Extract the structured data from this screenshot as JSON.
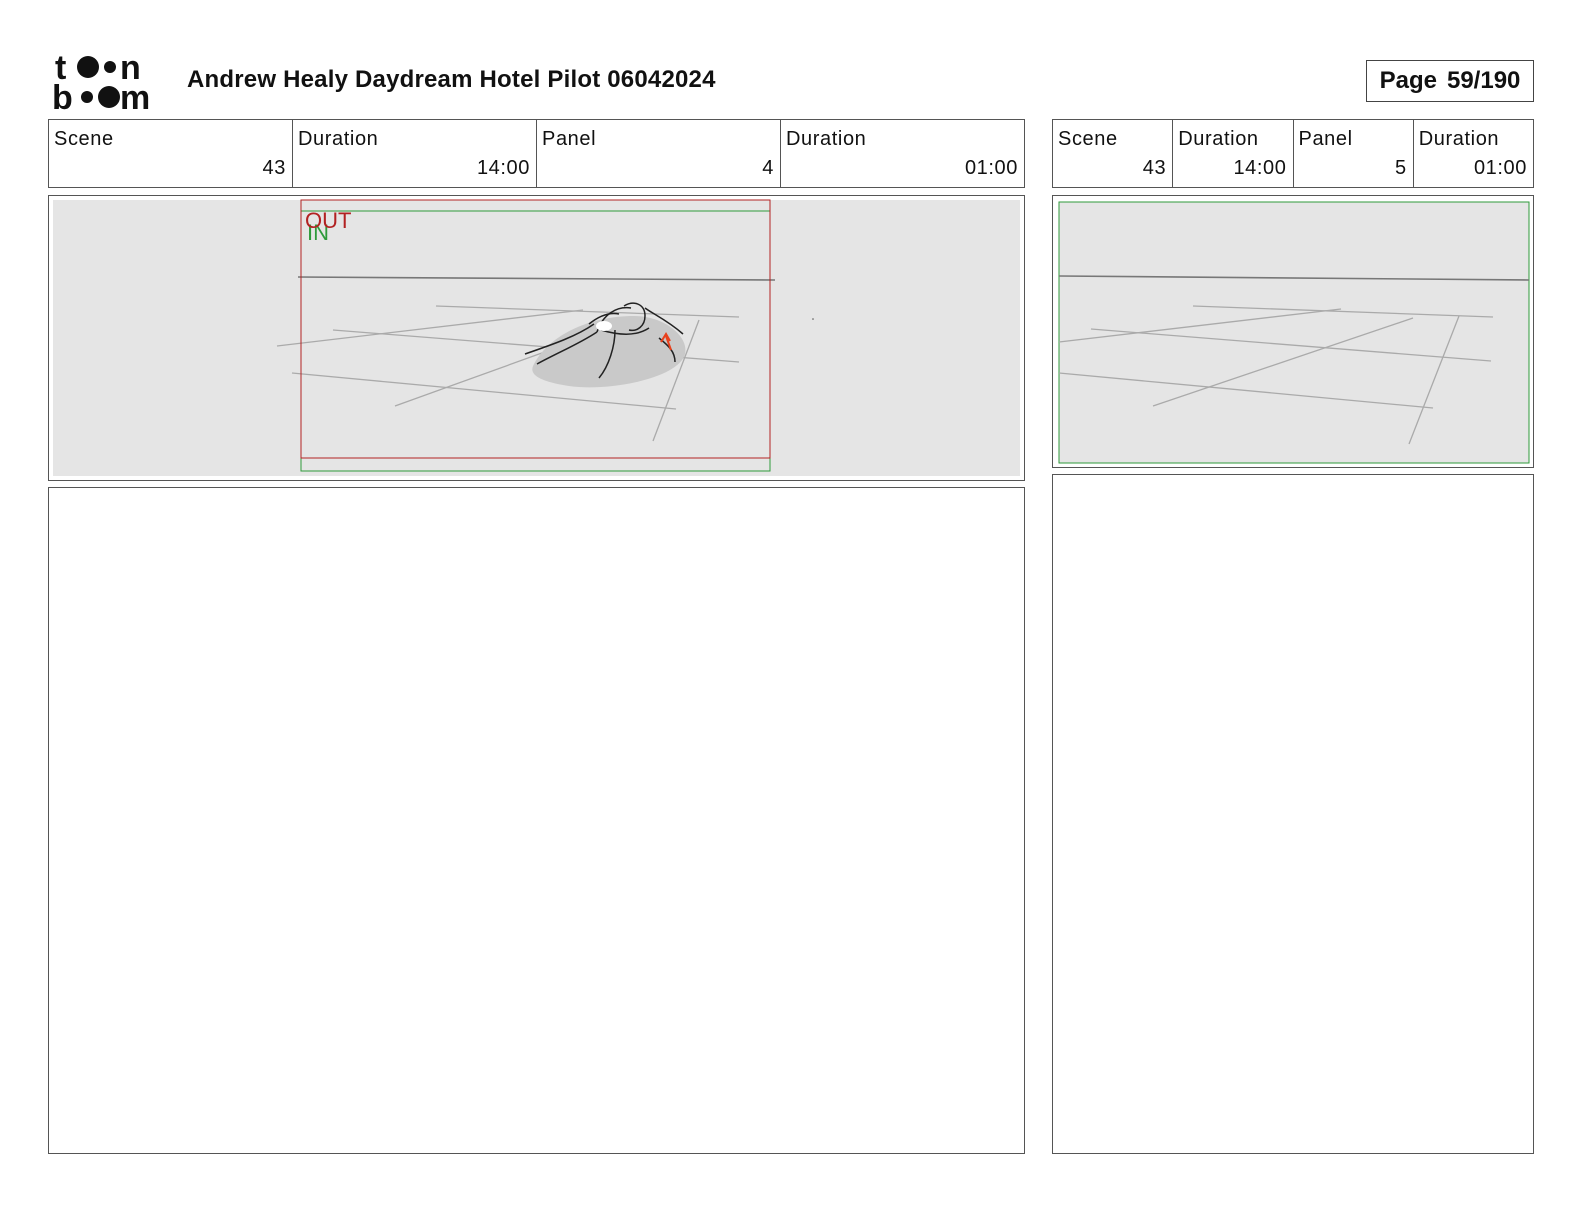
{
  "header": {
    "logo_text": "toon boom",
    "title": "Andrew Healy Daydream Hotel Pilot 06042024",
    "page_label": "Page",
    "page_value": "59/190"
  },
  "panels": [
    {
      "fields": [
        {
          "label": "Scene",
          "value": "43"
        },
        {
          "label": "Duration",
          "value": "14:00"
        },
        {
          "label": "Panel",
          "value": "4"
        },
        {
          "label": "Duration",
          "value": "01:00"
        }
      ],
      "frame_labels": {
        "out": "OUT",
        "in": "IN"
      },
      "notes": ""
    },
    {
      "fields": [
        {
          "label": "Scene",
          "value": "43"
        },
        {
          "label": "Duration",
          "value": "14:00"
        },
        {
          "label": "Panel",
          "value": "5"
        },
        {
          "label": "Duration",
          "value": "01:00"
        }
      ],
      "notes": ""
    }
  ],
  "colors": {
    "out_frame": "#b22222",
    "in_frame": "#2e9a3a",
    "sketch_bg": "#e5e5e5",
    "direction_arrow": "#e8401c"
  }
}
